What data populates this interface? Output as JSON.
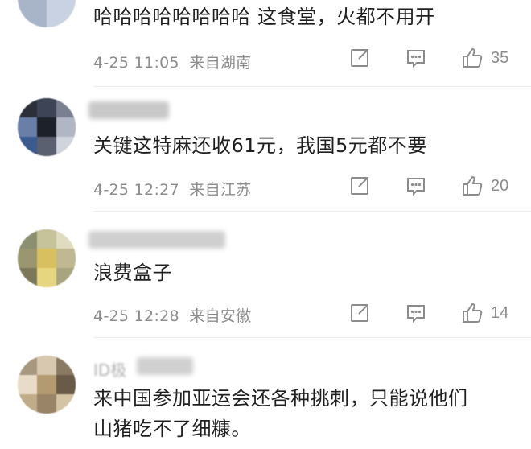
{
  "comments": [
    {
      "text": "哈哈哈哈哈哈哈哈  这食堂，火都不用开",
      "date": "4-25",
      "time": "11:05",
      "location": "来自湖南",
      "likes": "35"
    },
    {
      "text": "关键这特麻还收61元，我国5元都不要",
      "date": "4-25",
      "time": "12:27",
      "location": "来自江苏",
      "likes": "20"
    },
    {
      "text": "浪费盒子",
      "date": "4-25",
      "time": "12:28",
      "location": "来自安徽",
      "likes": "14"
    },
    {
      "username_partial": "ID极",
      "text_line1": "来中国参加亚运会还各种挑刺，只能说他们",
      "text_line2": "山猪吃不了细糠。"
    }
  ],
  "icons": {
    "repost": "repost-icon",
    "comment": "comment-icon",
    "like": "thumbs-up-icon"
  },
  "colors": {
    "meta_text": "#8c8c8c",
    "divider": "#ececec"
  }
}
